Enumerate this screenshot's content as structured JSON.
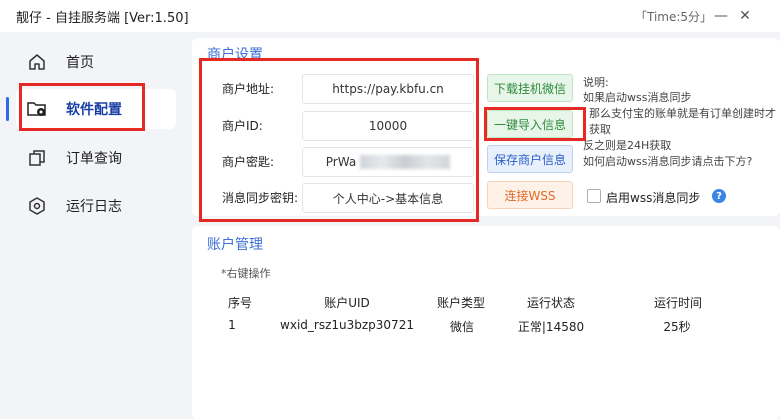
{
  "window": {
    "title": "靓仔 - 自挂服务端  [Ver:1.50]",
    "time_label": "「Time:5分」",
    "minimize": "—",
    "close": "✕"
  },
  "sidebar": {
    "items": [
      {
        "label": "首页",
        "icon": "home-icon"
      },
      {
        "label": "软件配置",
        "icon": "folder-gear-icon",
        "active": true
      },
      {
        "label": "订单查询",
        "icon": "copy-icon"
      },
      {
        "label": "运行日志",
        "icon": "hexagon-gear-icon"
      }
    ]
  },
  "merchant": {
    "section_title": "商户设置",
    "address_label": "商户地址:",
    "address_value": "https://pay.kbfu.cn",
    "id_label": "商户ID:",
    "id_value": "10000",
    "key_label": "商户密匙:",
    "key_value": "PrWa",
    "sync_key_label": "消息同步密钥:",
    "sync_key_value": "个人中心->基本信息"
  },
  "buttons": {
    "download": "下载挂机微信",
    "import": "一键导入信息",
    "save": "保存商户信息",
    "connect": "连接WSS"
  },
  "notes": {
    "lines": [
      "说明:",
      "如果启动wss消息同步",
      "那么支付宝的账单就是有订单创建时才",
      "获取",
      "反之则是24H获取",
      "如何启动wss消息同步请点击下方?"
    ],
    "enable_wss_label": "启用wss消息同步",
    "help": "?"
  },
  "accounts": {
    "section_title": "账户管理",
    "hint": "*右键操作",
    "columns": [
      "序号",
      "账户UID",
      "账户类型",
      "运行状态",
      "运行时间"
    ],
    "rows": [
      [
        "1",
        "wxid_rsz1u3bzp30721",
        "微信",
        "正常|14580",
        "25秒"
      ]
    ]
  },
  "colors": {
    "accent": "#3d6fd6",
    "highlight_box": "#e52a24",
    "sidebar_bg": "#f2f4f7"
  }
}
